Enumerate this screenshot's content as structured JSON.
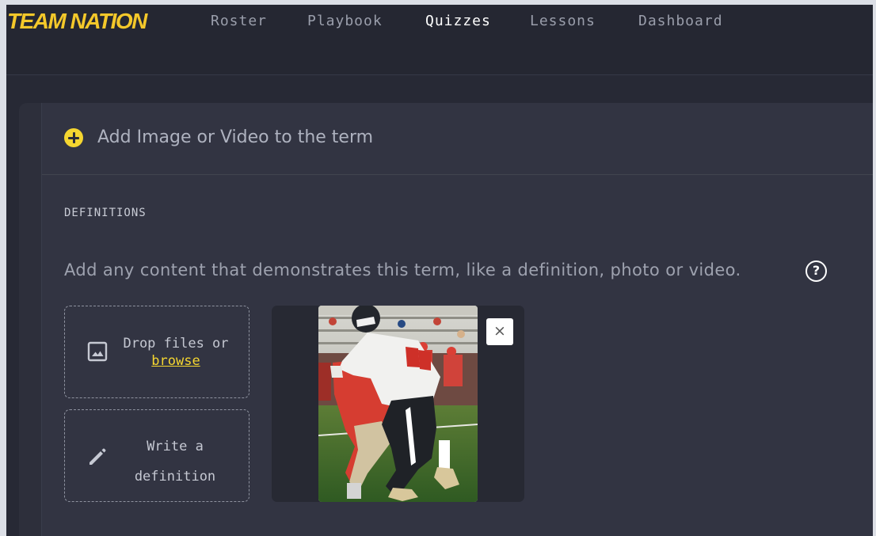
{
  "app": {
    "logo_text": "TEAM NATION",
    "accent_color": "#f5d630"
  },
  "nav": {
    "items": [
      {
        "label": "Roster",
        "active": false
      },
      {
        "label": "Playbook",
        "active": false
      },
      {
        "label": "Quizzes",
        "active": true
      },
      {
        "label": "Lessons",
        "active": false
      },
      {
        "label": "Dashboard",
        "active": false
      }
    ]
  },
  "term_editor": {
    "add_media_label": "Add Image or Video to the term",
    "definitions_title": "DEFINITIONS",
    "hint_text": "Add any content that demonstrates this term, like a definition, photo or video.",
    "help_icon": "question-circle-icon",
    "dropzone": {
      "icon": "image-icon",
      "text": "Drop files or",
      "link_text": "browse"
    },
    "write_box": {
      "icon": "pencil-icon",
      "line1": "Write a",
      "line2": "definition"
    },
    "media_item": {
      "type": "photo",
      "subject": "football players tackling",
      "remove_icon": "close-icon",
      "remove_symbol": "×"
    }
  }
}
